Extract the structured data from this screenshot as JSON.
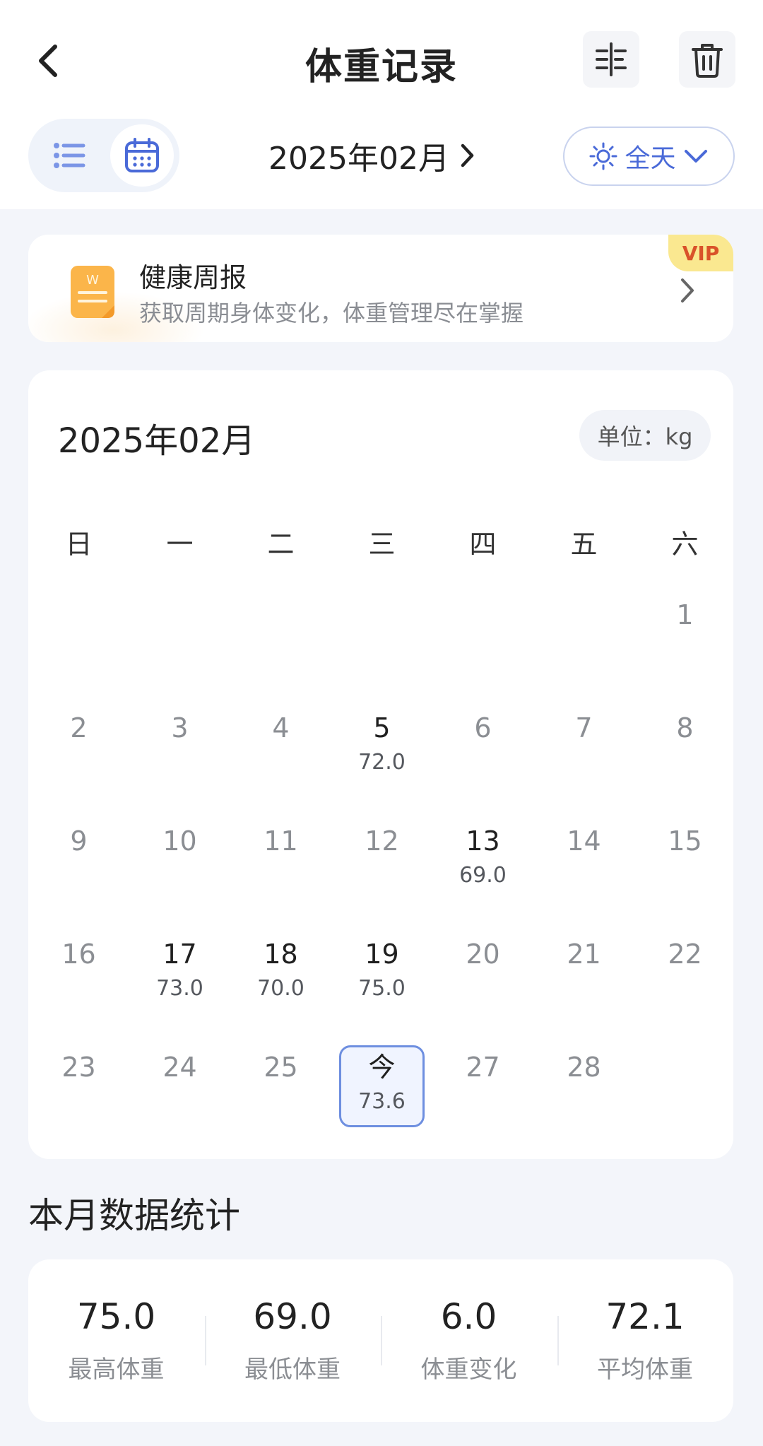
{
  "header": {
    "title": "体重记录"
  },
  "toolbar": {
    "month": "2025年02月",
    "time_filter": "全天"
  },
  "report": {
    "title": "健康周报",
    "subtitle": "获取周期身体变化，体重管理尽在掌握",
    "badge": "VIP"
  },
  "calendar": {
    "title": "2025年02月",
    "unit": "单位：kg",
    "weekdays": [
      "日",
      "一",
      "二",
      "三",
      "四",
      "五",
      "六"
    ],
    "start_weekday_index": 6,
    "days": [
      {
        "label": "1"
      },
      {
        "label": "2"
      },
      {
        "label": "3"
      },
      {
        "label": "4"
      },
      {
        "label": "5",
        "weight": "72.0"
      },
      {
        "label": "6"
      },
      {
        "label": "7"
      },
      {
        "label": "8"
      },
      {
        "label": "9"
      },
      {
        "label": "10"
      },
      {
        "label": "11"
      },
      {
        "label": "12"
      },
      {
        "label": "13",
        "weight": "69.0"
      },
      {
        "label": "14"
      },
      {
        "label": "15"
      },
      {
        "label": "16"
      },
      {
        "label": "17",
        "weight": "73.0"
      },
      {
        "label": "18",
        "weight": "70.0"
      },
      {
        "label": "19",
        "weight": "75.0"
      },
      {
        "label": "20"
      },
      {
        "label": "21"
      },
      {
        "label": "22"
      },
      {
        "label": "23"
      },
      {
        "label": "24"
      },
      {
        "label": "25"
      },
      {
        "label": "今",
        "weight": "73.6",
        "today": true
      },
      {
        "label": "27"
      },
      {
        "label": "28"
      }
    ]
  },
  "stats": {
    "heading": "本月数据统计",
    "items": [
      {
        "value": "75.0",
        "label": "最高体重"
      },
      {
        "value": "69.0",
        "label": "最低体重"
      },
      {
        "value": "6.0",
        "label": "体重变化"
      },
      {
        "value": "72.1",
        "label": "平均体重"
      }
    ]
  },
  "colors": {
    "accent": "#4a6ad8",
    "today_border": "#6e8fe0",
    "vip_bg": "#fae890",
    "vip_text": "#d9522a"
  }
}
